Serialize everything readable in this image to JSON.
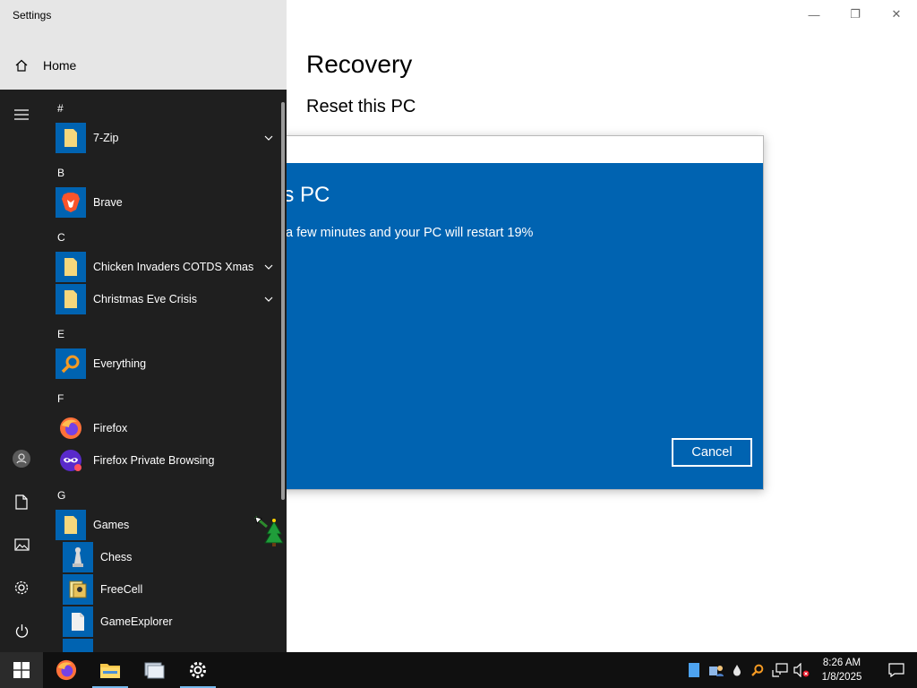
{
  "settings": {
    "window_title": "Settings",
    "home_label": "Home",
    "page_title": "Recovery",
    "section_title": "Reset this PC",
    "controls": {
      "minimize": "—",
      "maximize": "❐",
      "close": "✕"
    }
  },
  "dialog": {
    "heading": "is PC",
    "message": "a few minutes and your PC will restart 19%",
    "progress_percent": 19,
    "cancel_label": "Cancel",
    "accent_color": "#0063b1"
  },
  "start_menu": {
    "groups": [
      {
        "letter": "#",
        "apps": [
          {
            "label": "7-Zip",
            "icon": "folder-icon",
            "expandable": true
          }
        ]
      },
      {
        "letter": "B",
        "apps": [
          {
            "label": "Brave",
            "icon": "brave-icon",
            "expandable": false
          }
        ]
      },
      {
        "letter": "C",
        "apps": [
          {
            "label": "Chicken Invaders COTDS Xmas",
            "icon": "folder-icon",
            "expandable": true
          },
          {
            "label": "Christmas Eve Crisis",
            "icon": "folder-icon",
            "expandable": true
          }
        ]
      },
      {
        "letter": "E",
        "apps": [
          {
            "label": "Everything",
            "icon": "magnifier-icon",
            "expandable": false
          }
        ]
      },
      {
        "letter": "F",
        "apps": [
          {
            "label": "Firefox",
            "icon": "firefox-icon",
            "expandable": false
          },
          {
            "label": "Firefox Private Browsing",
            "icon": "firefox-private-icon",
            "expandable": false
          }
        ]
      },
      {
        "letter": "G",
        "apps": [
          {
            "label": "Games",
            "icon": "folder-icon",
            "expandable": false
          },
          {
            "label": "Chess",
            "icon": "chess-icon",
            "expandable": false
          },
          {
            "label": "FreeCell",
            "icon": "freecell-icon",
            "expandable": false
          },
          {
            "label": "GameExplorer",
            "icon": "document-icon",
            "expandable": false
          }
        ]
      }
    ]
  },
  "taskbar": {
    "clock_time": "8:26 AM",
    "clock_date": "1/8/2025"
  }
}
